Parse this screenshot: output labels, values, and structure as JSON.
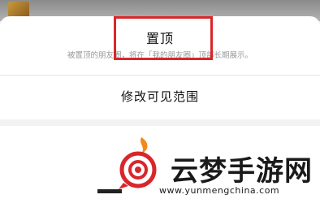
{
  "pin_option": {
    "title": "置顶",
    "description": "被置顶的朋友圈，将在「我的朋友圈」顶部长期展示。"
  },
  "visibility_option": {
    "label": "修改可见范围"
  },
  "watermark": {
    "brand": "云梦手游网",
    "url": "www.yunmengchina.com"
  },
  "colors": {
    "highlight": "#d9262a",
    "logo_red": "#d9262a",
    "logo_orange": "#f08a1c"
  }
}
